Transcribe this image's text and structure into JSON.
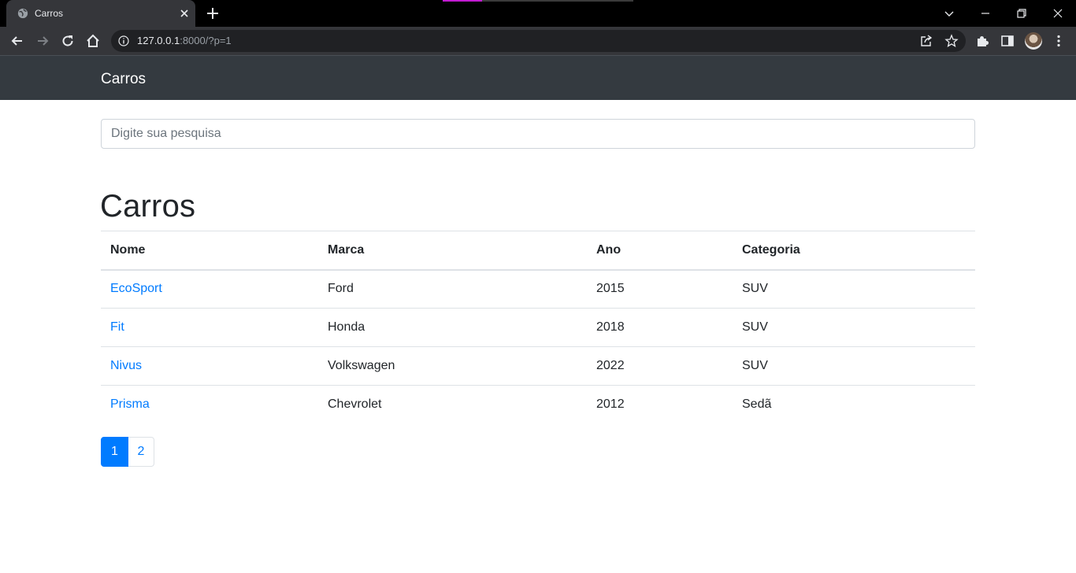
{
  "browser": {
    "tab_title": "Carros",
    "url_host": "127.0.0.1",
    "url_rest": ":8000/?p=1"
  },
  "navbar": {
    "brand": "Carros"
  },
  "search": {
    "placeholder": "Digite sua pesquisa"
  },
  "main": {
    "heading": "Carros",
    "table": {
      "headers": [
        "Nome",
        "Marca",
        "Ano",
        "Categoria"
      ],
      "rows": [
        {
          "nome": "EcoSport",
          "marca": "Ford",
          "ano": "2015",
          "categoria": "SUV"
        },
        {
          "nome": "Fit",
          "marca": "Honda",
          "ano": "2018",
          "categoria": "SUV"
        },
        {
          "nome": "Nivus",
          "marca": "Volkswagen",
          "ano": "2022",
          "categoria": "SUV"
        },
        {
          "nome": "Prisma",
          "marca": "Chevrolet",
          "ano": "2012",
          "categoria": "Sedã"
        }
      ]
    },
    "pagination": {
      "pages": [
        "1",
        "2"
      ],
      "active": "1"
    }
  },
  "colors": {
    "navbar_bg": "#343a40",
    "link": "#007bff",
    "active_page": "#007bff"
  }
}
